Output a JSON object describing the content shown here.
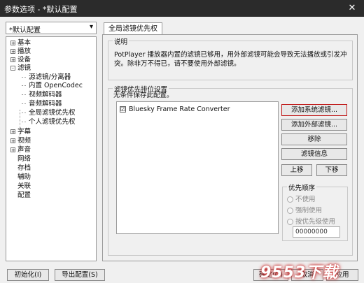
{
  "window": {
    "title": "参数选项 - *默认配置",
    "close_glyph": "✕"
  },
  "profile_select": {
    "value": "*默认配置",
    "arrow": "▾"
  },
  "tree": [
    {
      "label": "基本",
      "expander": "+"
    },
    {
      "label": "播放",
      "expander": "+"
    },
    {
      "label": "设备",
      "expander": "+"
    },
    {
      "label": "滤镜",
      "expander": "-"
    },
    {
      "label": "源滤镜/分离器",
      "child": true
    },
    {
      "label": "内置 OpenCodec",
      "child": true
    },
    {
      "label": "视频解码器",
      "child": true
    },
    {
      "label": "音频解码器",
      "child": true
    },
    {
      "label": "全局滤镜优先权",
      "child": true
    },
    {
      "label": "个人滤镜优先权",
      "child": true
    },
    {
      "label": "字幕",
      "expander": "+"
    },
    {
      "label": "视频",
      "expander": "+"
    },
    {
      "label": "声音",
      "expander": "+"
    },
    {
      "label": "网络"
    },
    {
      "label": "存档"
    },
    {
      "label": "辅助"
    },
    {
      "label": "关联"
    },
    {
      "label": "配置"
    }
  ],
  "tab": {
    "label": "全局滤镜优先权"
  },
  "description": {
    "title": "说明",
    "text": "PotPlayer 播放器内置的滤镜已够用，用外部滤镜可能会导致无法播放或引发冲突。除非万不得已，请不要使用外部滤镜。"
  },
  "priority_settings": {
    "title": "滤镜优先排位设置",
    "note": "无条件保存此配置。",
    "filters": [
      {
        "name": "Bluesky Frame Rate Converter",
        "checked": "☑"
      }
    ]
  },
  "buttons": {
    "add_system": "添加系统滤镜...",
    "add_external": "添加外部滤镜...",
    "remove": "移除",
    "info": "滤镜信息",
    "up": "上移",
    "down": "下移"
  },
  "priority_order": {
    "title": "优先顺序",
    "options": [
      "不使用",
      "强制使用",
      "按优先级使用"
    ],
    "value": "00000000"
  },
  "footer": {
    "init": "初始化(I)",
    "export": "导出配置(S)",
    "ok": "确定(O)",
    "cancel": "取消",
    "apply": "应用"
  },
  "watermark": {
    "text": "9553下载"
  }
}
